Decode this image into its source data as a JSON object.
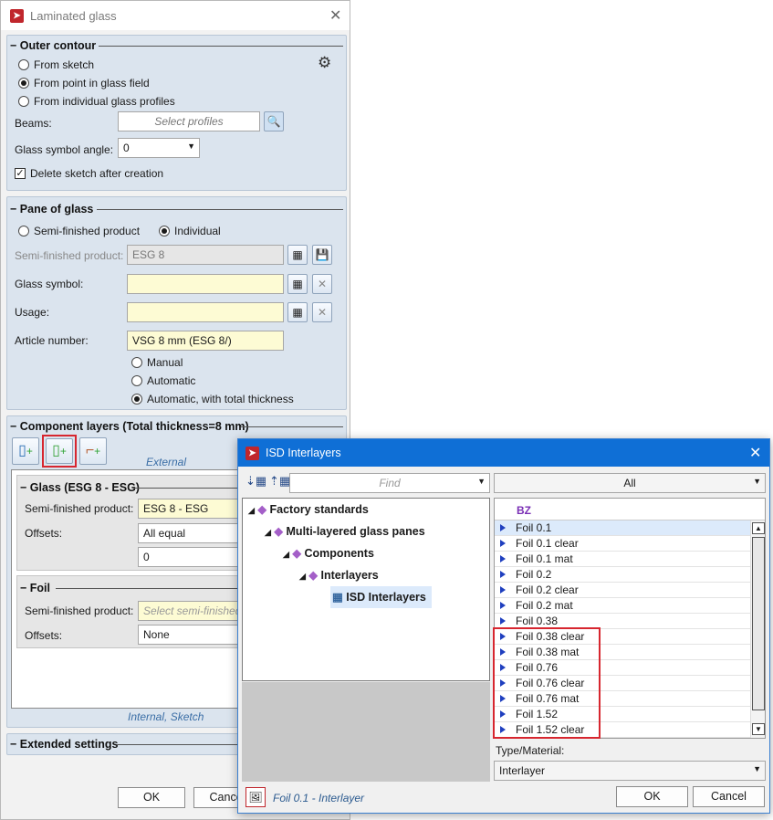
{
  "dialog": {
    "title": "Laminated glass",
    "outer_contour": {
      "heading": "Outer contour",
      "options": [
        "From sketch",
        "From point in glass field",
        "From individual glass profiles"
      ],
      "selected": 1,
      "beams_label": "Beams:",
      "beams_placeholder": "Select profiles",
      "angle_label": "Glass symbol angle:",
      "angle_value": "0",
      "delete_sketch_label": "Delete sketch after creation",
      "delete_sketch_checked": true
    },
    "pane": {
      "heading": "Pane of glass",
      "options": [
        "Semi-finished product",
        "Individual"
      ],
      "selected": 1,
      "semi_label": "Semi-finished product:",
      "semi_value": "ESG 8",
      "symbol_label": "Glass symbol:",
      "symbol_value": "",
      "usage_label": "Usage:",
      "usage_value": "",
      "article_label": "Article number:",
      "article_value": "VSG 8 mm (ESG 8/)",
      "article_modes": [
        "Manual",
        "Automatic",
        "Automatic, with total thickness"
      ],
      "article_mode_selected": 2
    },
    "layers": {
      "heading": "Component layers (Total thickness=8 mm)",
      "external_label": "External",
      "internal_label": "Internal, Sketch",
      "glass": {
        "heading": "Glass (ESG 8 - ESG)",
        "semi_label": "Semi-finished product:",
        "semi_value": "ESG 8 - ESG",
        "offsets_label": "Offsets:",
        "offsets_value": "All equal",
        "offset_number": "0"
      },
      "foil": {
        "heading": "Foil",
        "semi_label": "Semi-finished product:",
        "semi_placeholder": "Select semi-finished p",
        "offsets_label": "Offsets:",
        "offsets_value": "None"
      }
    },
    "extended": {
      "heading": "Extended settings"
    },
    "ok_label": "OK",
    "cancel_label": "Cancel"
  },
  "popup": {
    "title": "ISD Interlayers",
    "find_placeholder": "Find",
    "filter_value": "All",
    "tree": [
      "Factory standards",
      "Multi-layered glass panes",
      "Components",
      "Interlayers",
      "ISD Interlayers"
    ],
    "column_header": "BZ",
    "items": [
      "Foil 0.1",
      "Foil 0.1 clear",
      "Foil 0.1 mat",
      "Foil 0.2",
      "Foil 0.2 clear",
      "Foil 0.2 mat",
      "Foil 0.38",
      "Foil 0.38 clear",
      "Foil 0.38 mat",
      "Foil 0.76",
      "Foil 0.76 clear",
      "Foil 0.76 mat",
      "Foil 1.52",
      "Foil 1.52 clear"
    ],
    "type_label": "Type/Material:",
    "type_value": "Interlayer",
    "status_text": "Foil 0.1 - Interlayer",
    "ok_label": "OK",
    "cancel_label": "Cancel"
  },
  "colors": {
    "accent": "#0f6fd6",
    "highlight": "#d7262f",
    "panel": "#dbe4ee",
    "input_yellow": "#fdfbd4"
  }
}
